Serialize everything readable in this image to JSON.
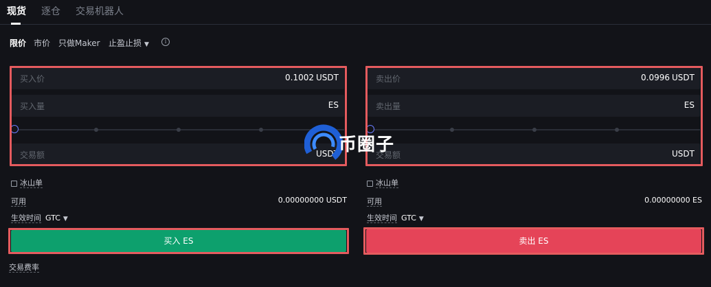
{
  "tabs": [
    {
      "label": "现货",
      "active": true
    },
    {
      "label": "逐仓",
      "active": false
    },
    {
      "label": "交易机器人",
      "active": false
    }
  ],
  "order_types": {
    "limit": "限价",
    "market": "市价",
    "maker_only": "只做Maker",
    "stop": "止盈止损",
    "info_icon": "info-icon"
  },
  "buy": {
    "price_label": "买入价",
    "price_value": "0.1002",
    "price_unit": "USDT",
    "amount_label": "买入量",
    "amount_unit": "ES",
    "total_label": "交易额",
    "total_unit": "USDT",
    "iceberg_label": "冰山单",
    "available_label": "可用",
    "available_value": "0.00000000 USDT",
    "tif_label": "生效时间",
    "tif_value": "GTC",
    "button_label": "买入 ES",
    "fee_label": "交易费率"
  },
  "sell": {
    "price_label": "卖出价",
    "price_value": "0.0996",
    "price_unit": "USDT",
    "amount_label": "卖出量",
    "amount_unit": "ES",
    "total_label": "交易额",
    "total_unit": "USDT",
    "iceberg_label": "冰山单",
    "available_label": "可用",
    "available_value": "0.00000000 ES",
    "tif_label": "生效时间",
    "tif_value": "GTC",
    "button_label": "卖出 ES"
  },
  "watermark": {
    "text": "币圈子"
  },
  "colors": {
    "background": "#121318",
    "buy": "#0da06d",
    "sell": "#e54458",
    "highlight": "#e55b5e",
    "accent": "#6b7cff"
  }
}
